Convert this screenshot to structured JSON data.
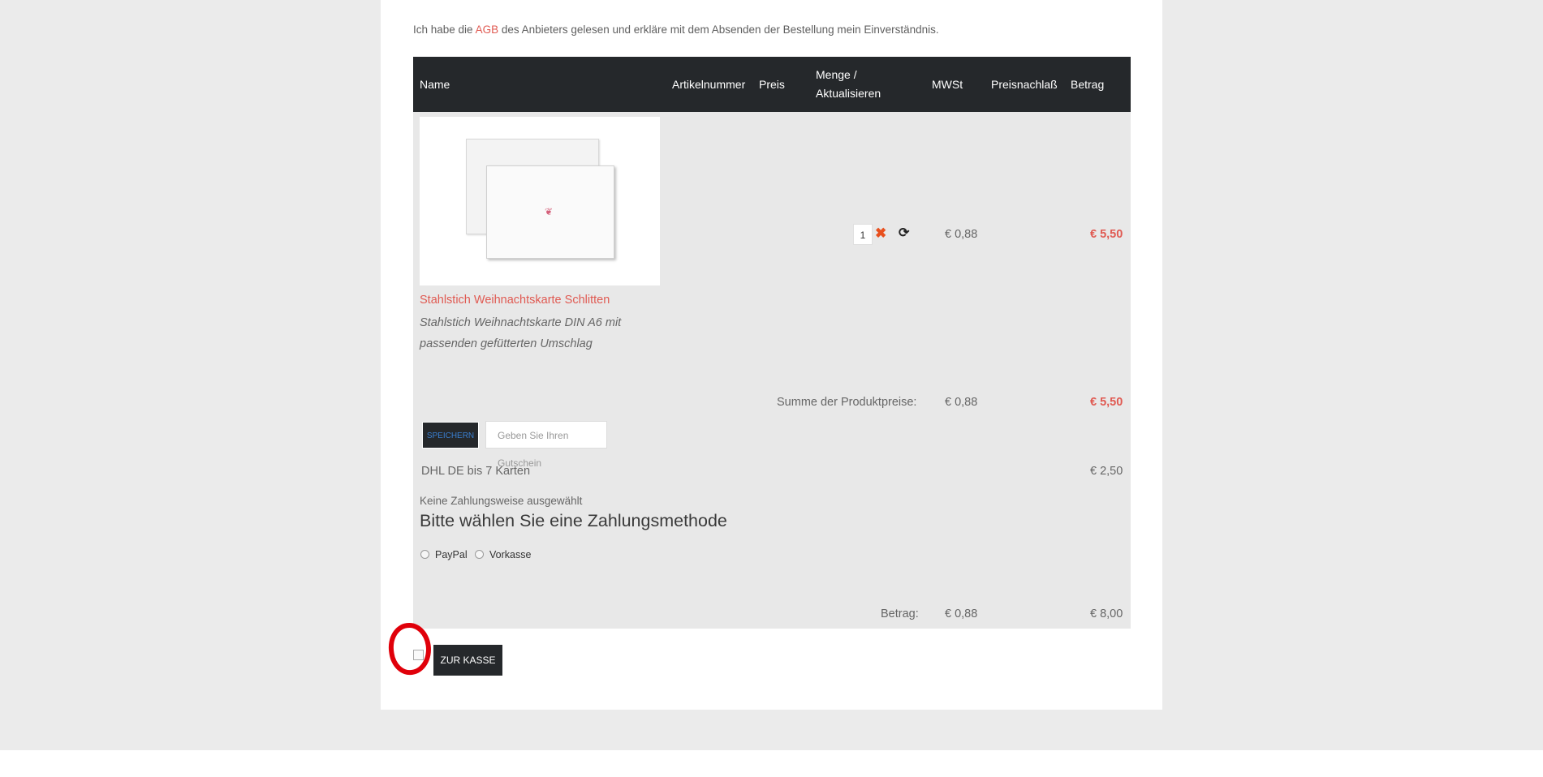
{
  "agb_notice": {
    "before": "Ich habe die",
    "link": "AGB",
    "after": "des Anbieters gelesen und erkläre mit dem Absenden der Bestellung mein Einverständnis."
  },
  "table": {
    "headers": {
      "name": "Name",
      "sku": "Artikelnummer",
      "price": "Preis",
      "qty_line1": "Menge /",
      "qty_line2": "Aktualisieren",
      "vat": "MWSt",
      "discount": "Preisnachlaß",
      "amount": "Betrag"
    }
  },
  "product": {
    "name": "Stahlstich Weihnachtskarte Schlitten",
    "description": "Stahlstich Weihnachtskarte DIN A6 mit passenden gefütterten Umschlag",
    "quantity": "1",
    "vat": "€ 0,88",
    "total": "€ 5,50"
  },
  "subtotal": {
    "label": "Summe der Produktpreise:",
    "vat": "€ 0,88",
    "total": "€ 5,50"
  },
  "coupon": {
    "save_label": "SPEICHERN",
    "placeholder": "Geben Sie Ihren Gutschein"
  },
  "shipping": {
    "label": "DHL DE bis 7 Karten",
    "price": "€ 2,50"
  },
  "payment": {
    "none_selected": "Keine Zahlungsweise ausgewählt",
    "heading": "Bitte wählen Sie eine Zahlungsmethode",
    "options": [
      "PayPal",
      "Vorkasse"
    ]
  },
  "total": {
    "label": "Betrag:",
    "vat": "€ 0,88",
    "amount": "€ 8,00"
  },
  "checkout": {
    "button_label": "ZUR KASSE"
  },
  "icons": {
    "delete": "delete-icon",
    "update": "refresh-icon"
  },
  "colors": {
    "accent_red": "#e05a52",
    "header_dark": "#25282b",
    "annotation_red": "#e0000a"
  }
}
